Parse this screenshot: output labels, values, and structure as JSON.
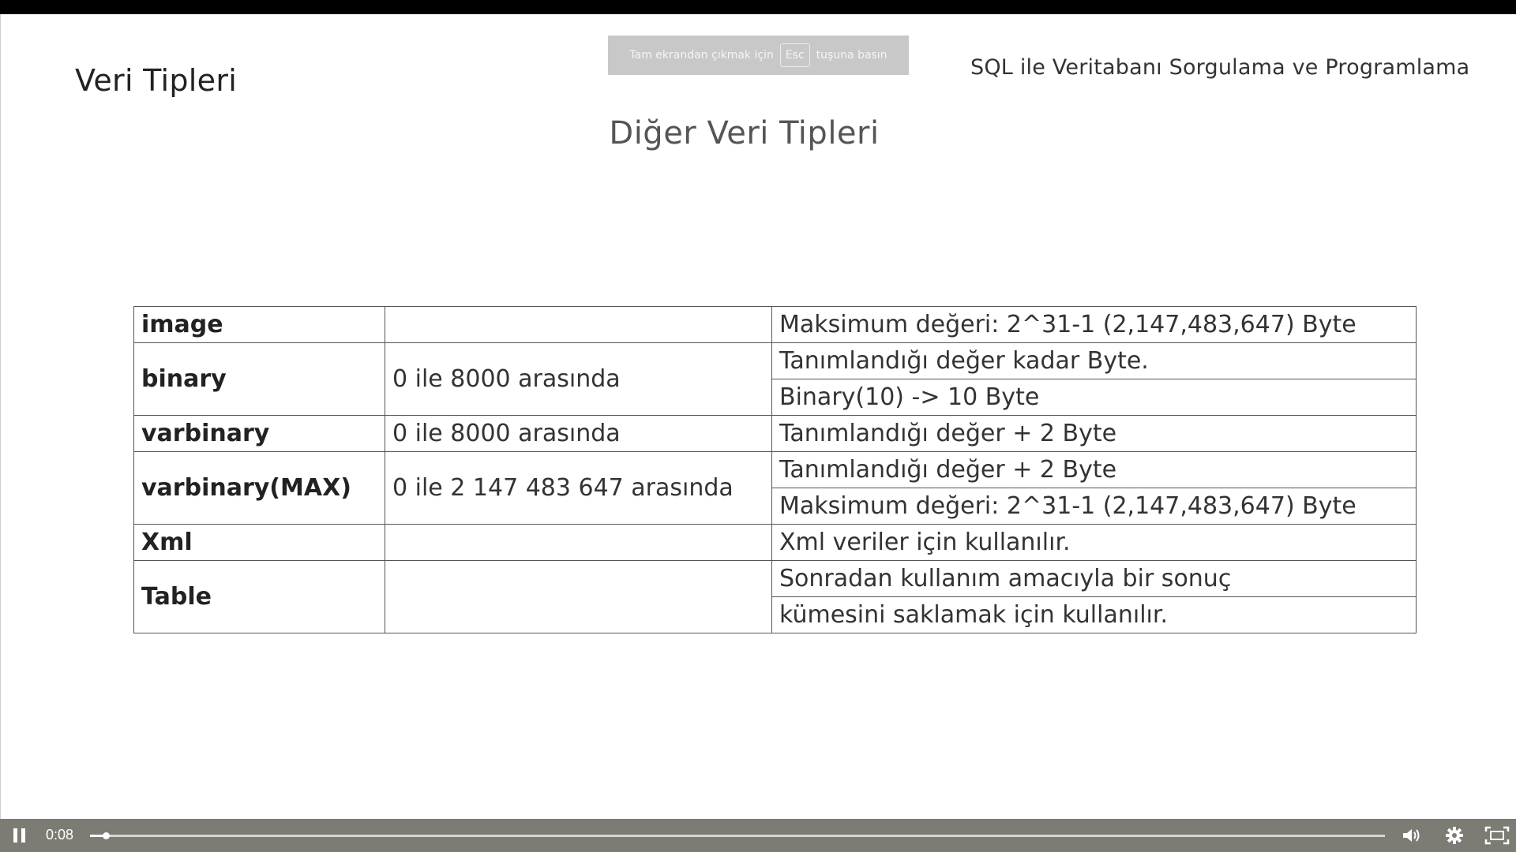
{
  "slide": {
    "title": "Veri Tipleri",
    "course_title": "SQL ile Veritabanı Sorgulama ve Programlama",
    "subtitle": "Diğer Veri Tipleri"
  },
  "fullscreen_toast": {
    "before": "Tam ekrandan çıkmak için",
    "key": "Esc",
    "after": "tuşuna basın"
  },
  "table": {
    "rows": [
      {
        "name": "image",
        "range": "",
        "notes": [
          "Maksimum değeri:  2^31-1 (2,147,483,647) Byte"
        ]
      },
      {
        "name": "binary",
        "range": "0 ile 8000 arasında",
        "notes": [
          "Tanımlandığı değer kadar Byte.",
          "Binary(10) -> 10 Byte"
        ]
      },
      {
        "name": "varbinary",
        "range": "0 ile 8000 arasında",
        "notes": [
          "Tanımlandığı değer + 2 Byte"
        ]
      },
      {
        "name": "varbinary(MAX)",
        "range": "0 ile 2 147 483 647 arasında",
        "notes": [
          "Tanımlandığı değer + 2 Byte",
          "Maksimum değeri:  2^31-1 (2,147,483,647) Byte"
        ]
      },
      {
        "name": "Xml",
        "range": "",
        "notes": [
          "Xml veriler için kullanılır."
        ]
      },
      {
        "name": "Table",
        "range": "",
        "notes": [
          "Sonradan kullanım amacıyla bir sonuç",
          "kümesini saklamak için kullanılır."
        ]
      }
    ]
  },
  "player": {
    "state": "playing",
    "current_time": "0:08",
    "progress": 0.012,
    "icons": {
      "pause": "pause-icon",
      "volume": "volume-icon",
      "settings": "gear-icon",
      "fullscreen": "exit-fullscreen-icon"
    }
  }
}
